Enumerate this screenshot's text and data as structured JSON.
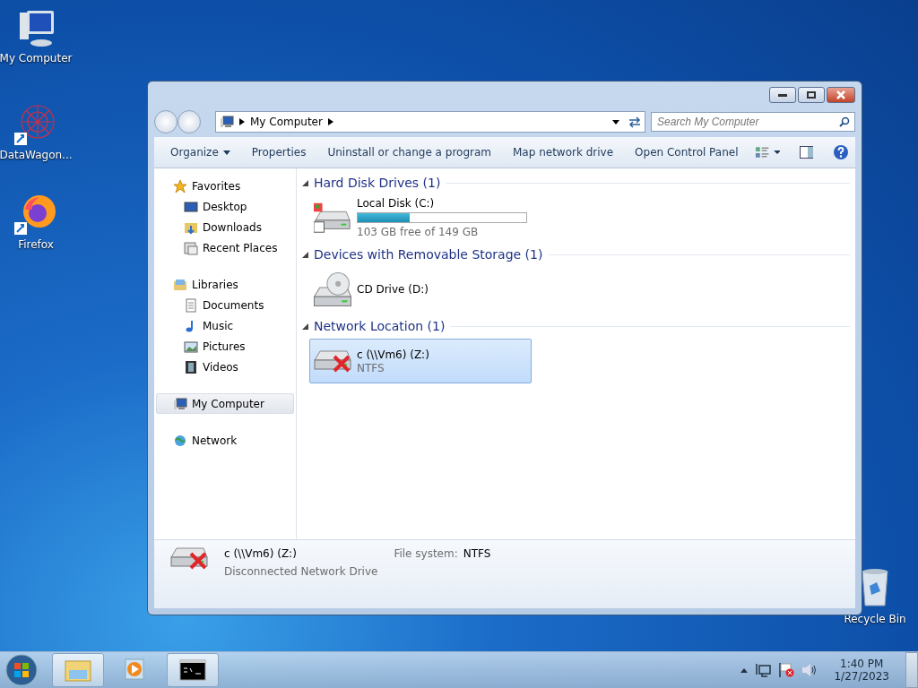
{
  "desktop_icons": [
    {
      "label": "My Computer",
      "kind": "computer",
      "shortcut": false
    },
    {
      "label": "DataWagon...",
      "kind": "web",
      "shortcut": true
    },
    {
      "label": "Firefox",
      "kind": "firefox",
      "shortcut": true
    },
    {
      "label": "Recycle Bin",
      "kind": "bin",
      "shortcut": false
    }
  ],
  "window": {
    "address": {
      "crumbs": [
        "My Computer"
      ]
    },
    "search": {
      "placeholder": "Search My Computer"
    },
    "toolbar": [
      {
        "label": "Organize",
        "kind": "menu"
      },
      {
        "label": "Properties",
        "kind": "button"
      },
      {
        "label": "Uninstall or change a program",
        "kind": "button"
      },
      {
        "label": "Map network drive",
        "kind": "button"
      },
      {
        "label": "Open Control Panel",
        "kind": "button"
      }
    ],
    "sidebar": [
      {
        "label": "Favorites",
        "kind": "star",
        "selected": false,
        "children": [
          {
            "label": "Desktop",
            "kind": "desktop",
            "selected": false
          },
          {
            "label": "Downloads",
            "kind": "downloads",
            "selected": false
          },
          {
            "label": "Recent Places",
            "kind": "recent",
            "selected": false
          }
        ]
      },
      {
        "label": "Libraries",
        "kind": "library",
        "selected": false,
        "children": [
          {
            "label": "Documents",
            "kind": "document",
            "selected": false
          },
          {
            "label": "Music",
            "kind": "music",
            "selected": false
          },
          {
            "label": "Pictures",
            "kind": "picture",
            "selected": false
          },
          {
            "label": "Videos",
            "kind": "video",
            "selected": false
          }
        ]
      },
      {
        "label": "My Computer",
        "kind": "computer",
        "selected": true
      },
      {
        "label": "Network",
        "kind": "network",
        "selected": false
      }
    ],
    "sections": [
      {
        "title": "Hard Disk Drives (1)",
        "items": [
          {
            "kind": "disk",
            "name": "Local Disk (C:)",
            "detail": "103 GB free of 149 GB",
            "level": 0.31,
            "selected": false
          }
        ]
      },
      {
        "title": "Devices with Removable Storage (1)",
        "items": [
          {
            "kind": "cd",
            "name": "CD Drive (D:)",
            "selected": false
          }
        ]
      },
      {
        "title": "Network Location (1)",
        "items": [
          {
            "kind": "netdrive",
            "name": "c (\\\\Vm6) (Z:)",
            "detail": "NTFS",
            "selected": true
          }
        ]
      }
    ],
    "details": {
      "name": "c (\\\\Vm6) (Z:)",
      "status": "Disconnected Network Drive",
      "field_label": "File system:",
      "field_value": "NTFS"
    }
  },
  "taskbar": {
    "apps": [
      {
        "kind": "explorer",
        "running": true
      },
      {
        "kind": "media",
        "running": false
      },
      {
        "kind": "terminal",
        "running": true
      }
    ],
    "clock": {
      "time": "1:40 PM",
      "date": "1/27/2023"
    }
  }
}
